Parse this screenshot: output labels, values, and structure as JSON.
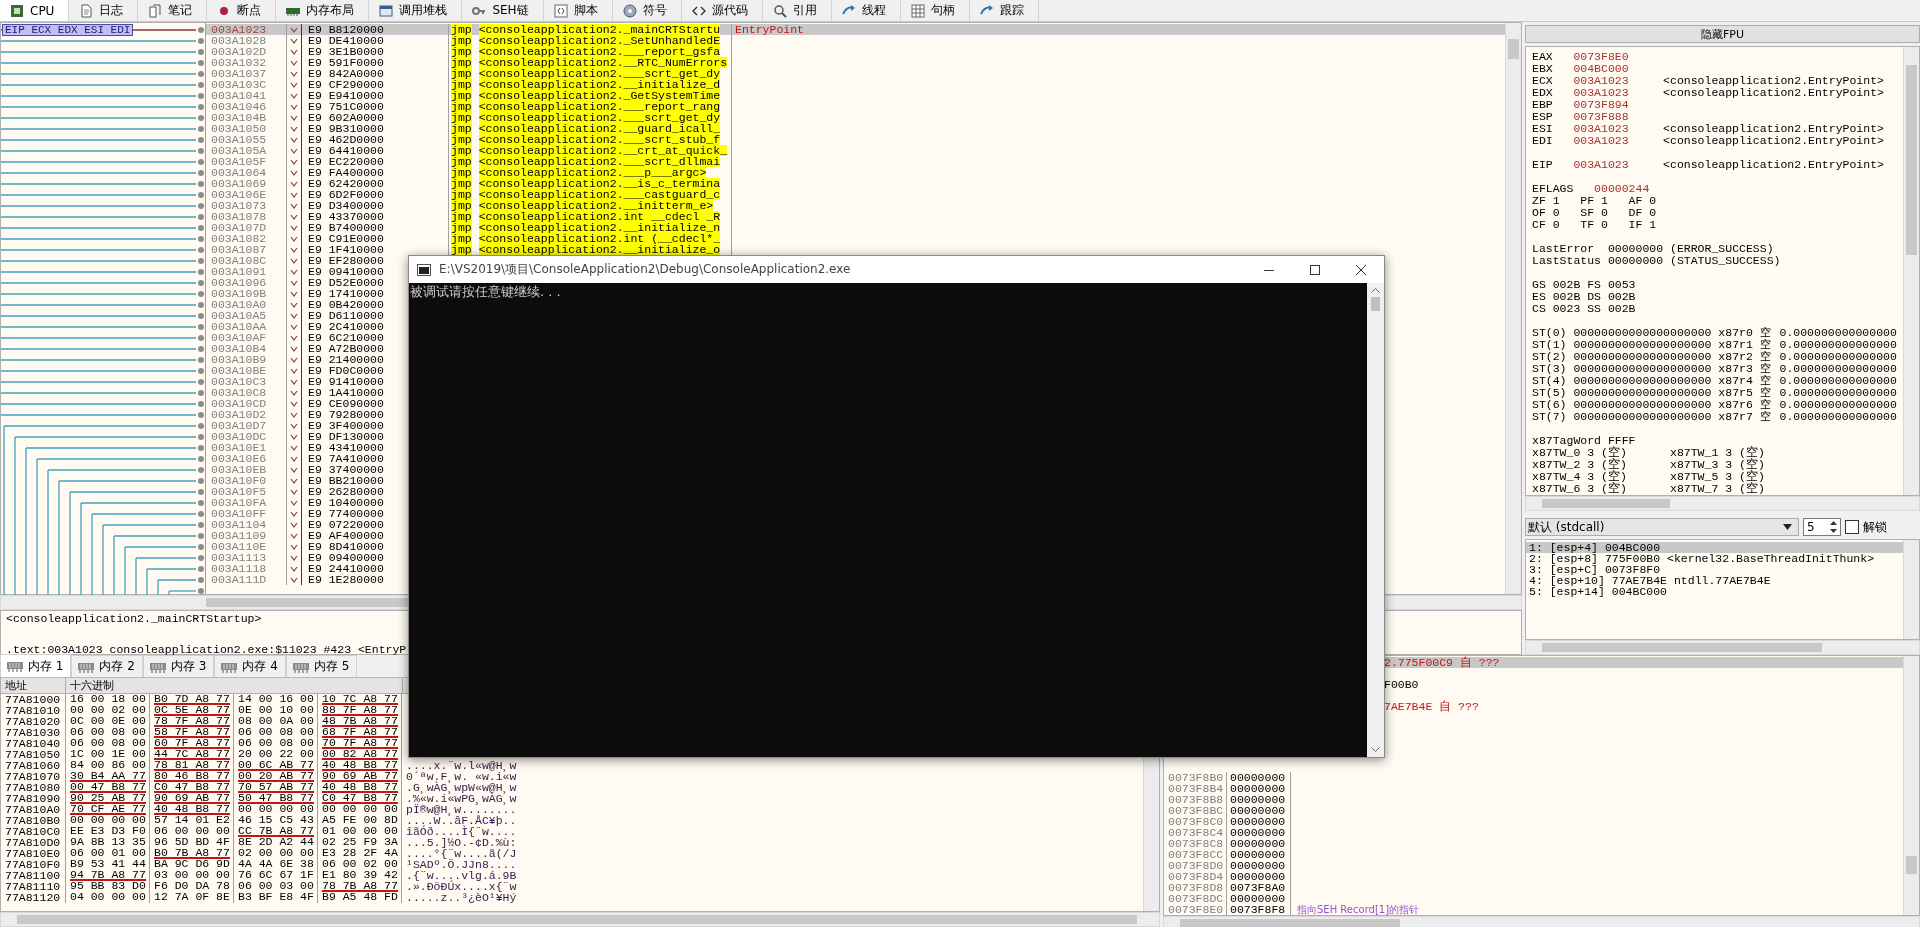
{
  "tabs": [
    {
      "label": "CPU",
      "selected": true
    },
    {
      "label": "日志",
      "selected": false
    },
    {
      "label": "笔记",
      "selected": false
    },
    {
      "label": "断点",
      "selected": false
    },
    {
      "label": "内存布局",
      "selected": false
    },
    {
      "label": "调用堆栈",
      "selected": false
    },
    {
      "label": "SEH链",
      "selected": false
    },
    {
      "label": "脚本",
      "selected": false
    },
    {
      "label": "符号",
      "selected": false
    },
    {
      "label": "源代码",
      "selected": false
    },
    {
      "label": "引用",
      "selected": false
    },
    {
      "label": "线程",
      "selected": false
    },
    {
      "label": "句柄",
      "selected": false
    },
    {
      "label": "跟踪",
      "selected": false
    }
  ],
  "disassembly": {
    "register_label": "EIP ECX EDX ESI EDI",
    "rows": [
      {
        "address": "003A1023",
        "bytes": "E9 B8120000",
        "mnemonic": "jmp",
        "operand": "<consoleapplication2._mainCRTStartu",
        "comment": "EntryPoint",
        "selected": true
      },
      {
        "address": "003A1028",
        "bytes": "E9 DE410000",
        "mnemonic": "jmp",
        "operand": "<consoleapplication2._SetUnhandledE",
        "selected": false
      },
      {
        "address": "003A102D",
        "bytes": "E9 3E1B0000",
        "mnemonic": "jmp",
        "operand": "<consoleapplication2.___report_gsfa",
        "selected": false
      },
      {
        "address": "003A1032",
        "bytes": "E9 591F0000",
        "mnemonic": "jmp",
        "operand": "<consoleapplication2.__RTC_NumErrors",
        "selected": false
      },
      {
        "address": "003A1037",
        "bytes": "E9 842A0000",
        "mnemonic": "jmp",
        "operand": "<consoleapplication2.___scrt_get_dy",
        "selected": false
      },
      {
        "address": "003A103C",
        "bytes": "E9 CF290000",
        "mnemonic": "jmp",
        "operand": "<consoleapplication2.__initialize_d",
        "selected": false
      },
      {
        "address": "003A1041",
        "bytes": "E9 E9410000",
        "mnemonic": "jmp",
        "operand": "<consoleapplication2._GetSystemTime",
        "selected": false
      },
      {
        "address": "003A1046",
        "bytes": "E9 751C0000",
        "mnemonic": "jmp",
        "operand": "<consoleapplication2.___report_rang",
        "selected": false
      },
      {
        "address": "003A104B",
        "bytes": "E9 602A0000",
        "mnemonic": "jmp",
        "operand": "<consoleapplication2.___scrt_get_dy",
        "selected": false
      },
      {
        "address": "003A1050",
        "bytes": "E9 9B310000",
        "mnemonic": "jmp",
        "operand": "<consoleapplication2.__guard_icall_",
        "selected": false
      },
      {
        "address": "003A1055",
        "bytes": "E9 462D0000",
        "mnemonic": "jmp",
        "operand": "<consoleapplication2.___scrt_stub_f",
        "selected": false
      },
      {
        "address": "003A105A",
        "bytes": "E9 64410000",
        "mnemonic": "jmp",
        "operand": "<consoleapplication2.__crt_at_quick_",
        "selected": false
      },
      {
        "address": "003A105F",
        "bytes": "E9 EC220000",
        "mnemonic": "jmp",
        "operand": "<consoleapplication2.___scrt_dllmai",
        "selected": false
      },
      {
        "address": "003A1064",
        "bytes": "E9 FA400000",
        "mnemonic": "jmp",
        "operand": "<consoleapplication2.___p___argc>",
        "selected": false
      },
      {
        "address": "003A1069",
        "bytes": "E9 62420000",
        "mnemonic": "jmp",
        "operand": "<consoleapplication2.__is_c_termina",
        "selected": false
      },
      {
        "address": "003A106E",
        "bytes": "E9 6D2F0000",
        "mnemonic": "jmp",
        "operand": "<consoleapplication2.___castguard_c",
        "selected": false
      },
      {
        "address": "003A1073",
        "bytes": "E9 D3400000",
        "mnemonic": "jmp",
        "operand": "<consoleapplication2.__initterm_e>",
        "selected": false
      },
      {
        "address": "003A1078",
        "bytes": "E9 43370000",
        "mnemonic": "jmp",
        "operand": "<consoleapplication2.int __cdecl _R",
        "selected": false
      },
      {
        "address": "003A107D",
        "bytes": "E9 B7400000",
        "mnemonic": "jmp",
        "operand": "<consoleapplication2.__initialize_n",
        "selected": false
      },
      {
        "address": "003A1082",
        "bytes": "E9 C91E0000",
        "mnemonic": "jmp",
        "operand": "<consoleapplication2.int (__cdecl*_",
        "selected": false
      },
      {
        "address": "003A1087",
        "bytes": "E9 1F410000",
        "mnemonic": "jmp",
        "operand": "<consoleapplication2.__initialize_o",
        "selected": false
      },
      {
        "address": "003A108C",
        "bytes": "E9 EF280000",
        "selected": false
      },
      {
        "address": "003A1091",
        "bytes": "E9 09410000",
        "selected": false
      },
      {
        "address": "003A1096",
        "bytes": "E9 D52E0000",
        "selected": false
      },
      {
        "address": "003A109B",
        "bytes": "E9 17410000",
        "selected": false
      },
      {
        "address": "003A10A0",
        "bytes": "E9 0B420000",
        "selected": false
      },
      {
        "address": "003A10A5",
        "bytes": "E9 D6110000",
        "selected": false
      },
      {
        "address": "003A10AA",
        "bytes": "E9 2C410000",
        "selected": false
      },
      {
        "address": "003A10AF",
        "bytes": "E9 6C210000",
        "selected": false
      },
      {
        "address": "003A10B4",
        "bytes": "E9 A72B0000",
        "selected": false
      },
      {
        "address": "003A10B9",
        "bytes": "E9 21400000",
        "selected": false
      },
      {
        "address": "003A10BE",
        "bytes": "E9 FD0C0000",
        "selected": false
      },
      {
        "address": "003A10C3",
        "bytes": "E9 91410000",
        "selected": false
      },
      {
        "address": "003A10C8",
        "bytes": "E9 1A410000",
        "selected": false
      },
      {
        "address": "003A10CD",
        "bytes": "E9 CE090000",
        "selected": false
      },
      {
        "address": "003A10D2",
        "bytes": "E9 79280000",
        "selected": false
      },
      {
        "address": "003A10D7",
        "bytes": "E9 3F400000",
        "selected": false
      },
      {
        "address": "003A10DC",
        "bytes": "E9 DF130000",
        "selected": false
      },
      {
        "address": "003A10E1",
        "bytes": "E9 43410000",
        "selected": false
      },
      {
        "address": "003A10E6",
        "bytes": "E9 7A410000",
        "selected": false
      },
      {
        "address": "003A10EB",
        "bytes": "E9 37400000",
        "selected": false
      },
      {
        "address": "003A10F0",
        "bytes": "E9 BB210000",
        "selected": false
      },
      {
        "address": "003A10F5",
        "bytes": "E9 26280000",
        "selected": false
      },
      {
        "address": "003A10FA",
        "bytes": "E9 10400000",
        "selected": false
      },
      {
        "address": "003A10FF",
        "bytes": "E9 77400000",
        "selected": false
      },
      {
        "address": "003A1104",
        "bytes": "E9 07220000",
        "selected": false
      },
      {
        "address": "003A1109",
        "bytes": "E9 AF400000",
        "selected": false
      },
      {
        "address": "003A110E",
        "bytes": "E9 8D410000",
        "selected": false
      },
      {
        "address": "003A1113",
        "bytes": "E9 09400000",
        "selected": false
      },
      {
        "address": "003A1118",
        "bytes": "E9 24410000",
        "selected": false
      },
      {
        "address": "003A111D",
        "bytes": "E9 1E280000",
        "selected": false
      }
    ]
  },
  "info": [
    "<consoleapplication2._mainCRTStartup>",
    ".text:003A1023 consoleapplication2.exe:$11023 #423 <EntryP"
  ],
  "registers": {
    "hide_fpu": "隐藏FPU",
    "general": [
      {
        "name": "EAX",
        "value": "0073F8E0"
      },
      {
        "name": "EBX",
        "value": "004BC000"
      },
      {
        "name": "ECX",
        "value": "003A1023",
        "comment": "<consoleapplication2.EntryPoint>"
      },
      {
        "name": "EDX",
        "value": "003A1023",
        "comment": "<consoleapplication2.EntryPoint>"
      },
      {
        "name": "EBP",
        "value": "0073F894"
      },
      {
        "name": "ESP",
        "value": "0073F888"
      },
      {
        "name": "ESI",
        "value": "003A1023",
        "comment": "<consoleapplication2.EntryPoint>"
      },
      {
        "name": "EDI",
        "value": "003A1023",
        "comment": "<consoleapplication2.EntryPoint>"
      }
    ],
    "eip": {
      "name": "EIP",
      "value": "003A1023",
      "comment": "<consoleapplication2.EntryPoint>"
    },
    "eflags": {
      "name": "EFLAGS",
      "value": "00000244"
    },
    "flags": [
      [
        {
          "name": "ZF",
          "value": "1"
        },
        {
          "name": "PF",
          "value": "1"
        },
        {
          "name": "AF",
          "value": "0"
        }
      ],
      [
        {
          "name": "OF",
          "value": "0"
        },
        {
          "name": "SF",
          "value": "0"
        },
        {
          "name": "DF",
          "value": "0"
        }
      ],
      [
        {
          "name": "CF",
          "value": "0"
        },
        {
          "name": "TF",
          "value": "0"
        },
        {
          "name": "IF",
          "value": "1"
        }
      ]
    ],
    "last": [
      {
        "name": "LastError",
        "value": "00000000",
        "comment": "(ERROR_SUCCESS)"
      },
      {
        "name": "LastStatus",
        "value": "00000000",
        "comment": "(STATUS_SUCCESS)"
      }
    ],
    "segments": [
      [
        {
          "name": "GS",
          "value": "002B"
        },
        {
          "name": "FS",
          "value": "0053"
        }
      ],
      [
        {
          "name": "ES",
          "value": "002B"
        },
        {
          "name": "DS",
          "value": "002B"
        }
      ],
      [
        {
          "name": "CS",
          "value": "0023"
        },
        {
          "name": "SS",
          "value": "002B"
        }
      ]
    ],
    "fpu": [
      {
        "name": "ST(0)",
        "value": "00000000000000000000",
        "tag_register": "x87r0",
        "tag": "空",
        "float": "0.000000000000000"
      },
      {
        "name": "ST(1)",
        "value": "00000000000000000000",
        "tag_register": "x87r1",
        "tag": "空",
        "float": "0.000000000000000"
      },
      {
        "name": "ST(2)",
        "value": "00000000000000000000",
        "tag_register": "x87r2",
        "tag": "空",
        "float": "0.000000000000000"
      },
      {
        "name": "ST(3)",
        "value": "00000000000000000000",
        "tag_register": "x87r3",
        "tag": "空",
        "float": "0.000000000000000"
      },
      {
        "name": "ST(4)",
        "value": "00000000000000000000",
        "tag_register": "x87r4",
        "tag": "空",
        "float": "0.000000000000000"
      },
      {
        "name": "ST(5)",
        "value": "00000000000000000000",
        "tag_register": "x87r5",
        "tag": "空",
        "float": "0.000000000000000"
      },
      {
        "name": "ST(6)",
        "value": "00000000000000000000",
        "tag_register": "x87r6",
        "tag": "空",
        "float": "0.000000000000000"
      },
      {
        "name": "ST(7)",
        "value": "00000000000000000000",
        "tag_register": "x87r7",
        "tag": "空",
        "float": "0.000000000000000"
      }
    ],
    "tag_word": {
      "name": "x87TagWord",
      "value": "FFFF"
    },
    "tag_words": [
      [
        {
          "name": "x87TW_0",
          "value": "3 (空)"
        },
        {
          "name": "x87TW_1",
          "value": "3 (空)"
        }
      ],
      [
        {
          "name": "x87TW_2",
          "value": "3 (空)"
        },
        {
          "name": "x87TW_3",
          "value": "3 (空)"
        }
      ],
      [
        {
          "name": "x87TW_4",
          "value": "3 (空)"
        },
        {
          "name": "x87TW_5",
          "value": "3 (空)"
        }
      ],
      [
        {
          "name": "x87TW_6",
          "value": "3 (空)"
        },
        {
          "name": "x87TW_7",
          "value": "3 (空)"
        }
      ]
    ]
  },
  "arguments": {
    "convention": "默认 (stdcall)",
    "count": "5",
    "unlock": {
      "label": "解锁",
      "checked": false
    },
    "rows": [
      {
        "text": "1: [esp+4] 004BC000",
        "selected": true
      },
      {
        "text": "2: [esp+8] 775F00B0 <kernel32.BaseThreadInitThunk>",
        "selected": false
      },
      {
        "text": "3: [esp+C] 0073F8F0",
        "selected": false
      },
      {
        "text": "4: [esp+10] 77AE7B4E ntdll.77AE7B4E",
        "selected": false
      },
      {
        "text": "5: [esp+14] 004BC000",
        "selected": false
      }
    ]
  },
  "memory_tabs": [
    {
      "label": "内存 1",
      "selected": true
    },
    {
      "label": "内存 2",
      "selected": false
    },
    {
      "label": "内存 3",
      "selected": false
    },
    {
      "label": "内存 4",
      "selected": false
    },
    {
      "label": "内存 5",
      "selected": false
    }
  ],
  "dump": {
    "columns": [
      "地址",
      "十六进制"
    ],
    "rows": [
      {
        "address": "77A81000",
        "groups": [
          "16 00 18 00",
          "B0 7D A8 77",
          "14 00 16 00",
          "10 7C A8 77"
        ],
        "underlined": [
          false,
          true,
          false,
          true
        ]
      },
      {
        "address": "77A81010",
        "groups": [
          "00 00 02 00",
          "0C 5E A8 77",
          "0E 00 10 00",
          "88 7F A8 77"
        ],
        "underlined": [
          false,
          true,
          false,
          true
        ]
      },
      {
        "address": "77A81020",
        "groups": [
          "0C 00 0E 00",
          "78 7F A8 77",
          "08 00 0A 00",
          "48 7B A8 77"
        ],
        "underlined": [
          false,
          true,
          false,
          true
        ]
      },
      {
        "address": "77A81030",
        "groups": [
          "06 00 08 00",
          "58 7F A8 77",
          "06 00 08 00",
          "68 7F A8 77"
        ],
        "underlined": [
          false,
          true,
          false,
          true
        ]
      },
      {
        "address": "77A81040",
        "groups": [
          "06 00 08 00",
          "60 7F A8 77",
          "06 00 08 00",
          "70 7F A8 77"
        ],
        "underlined": [
          false,
          true,
          false,
          true
        ]
      },
      {
        "address": "77A81050",
        "groups": [
          "1C 00 1E 00",
          "44 7C A8 77",
          "20 00 22 00",
          "00 82 A8 77"
        ],
        "underlined": [
          false,
          true,
          false,
          true
        ]
      },
      {
        "address": "77A81060",
        "groups": [
          "84 00 86 00",
          "78 81 A8 77",
          "00 6C AB 77",
          "40 48 B8 77"
        ],
        "underlined": [
          false,
          true,
          true,
          true
        ],
        "ascii": "....x.¨w.l«w@H¸w"
      },
      {
        "address": "77A81070",
        "groups": [
          "30 B4 AA 77",
          "80 46 B8 77",
          "00 20 AB 77",
          "90 69 AB 77"
        ],
        "underlined": [
          true,
          true,
          true,
          true
        ],
        "ascii": "0´ªw.F¸w. «w.i«w"
      },
      {
        "address": "77A81080",
        "groups": [
          "00 47 B8 77",
          "C0 47 B8 77",
          "70 57 AB 77",
          "40 48 B8 77"
        ],
        "underlined": [
          true,
          true,
          true,
          true
        ],
        "ascii": ".G¸wÀG¸wpW«w@H¸w"
      },
      {
        "address": "77A81090",
        "groups": [
          "90 25 AB 77",
          "90 69 AB 77",
          "50 47 B8 77",
          "C0 47 B8 77"
        ],
        "underlined": [
          true,
          true,
          true,
          true
        ],
        "ascii": ".%«w.i«wPG¸wÀG¸w"
      },
      {
        "address": "77A810A0",
        "groups": [
          "70 CF AE 77",
          "40 48 B8 77",
          "00 00 00 00",
          "00 00 00 00"
        ],
        "underlined": [
          true,
          true,
          false,
          false
        ],
        "ascii": "pÏ®w@H¸w........"
      },
      {
        "address": "77A810B0",
        "groups": [
          "00 00 00 00",
          "57 14 01 E2",
          "46 15 C5 43",
          "A5 FE 00 8D"
        ],
        "underlined": [
          false,
          false,
          false,
          false
        ],
        "ascii": "....W..âF.ÅC¥þ.."
      },
      {
        "address": "77A810C0",
        "groups": [
          "EE E3 D3 F0",
          "06 00 00 00",
          "CC 7B A8 77",
          "01 00 00 00"
        ],
        "underlined": [
          false,
          false,
          true,
          false
        ],
        "ascii": "îãÓð....Ì{¨w...."
      },
      {
        "address": "77A810D0",
        "groups": [
          "9A 8B 13 35",
          "96 5D BD 4F",
          "8E 2D A2 44",
          "02 25 F9 3A"
        ],
        "underlined": [
          false,
          false,
          false,
          false
        ],
        "ascii": "...5.]½O.-¢D.%ù:"
      },
      {
        "address": "77A810E0",
        "groups": [
          "06 00 01 00",
          "B0 7B A8 77",
          "02 00 00 00",
          "E3 28 2F 4A"
        ],
        "underlined": [
          false,
          true,
          false,
          false
        ],
        "ascii": "....°{¨w....ã(/J"
      },
      {
        "address": "77A810F0",
        "groups": [
          "B9 53 41 44",
          "BA 9C D6 9D",
          "4A 4A 6E 38",
          "06 00 02 00"
        ],
        "underlined": [
          false,
          false,
          false,
          false
        ],
        "ascii": "¹SADº.Ö.JJn8...."
      },
      {
        "address": "77A81100",
        "groups": [
          "94 7B A8 77",
          "03 00 00 00",
          "76 6C 67 1F",
          "E1 80 39 42"
        ],
        "underlined": [
          true,
          false,
          false,
          false
        ],
        "ascii": ".{¨w....vlg.á.9B"
      },
      {
        "address": "77A81110",
        "groups": [
          "95 BB 83 D0",
          "F6 D0 DA 78",
          "06 00 03 00",
          "78 7B A8 77"
        ],
        "underlined": [
          false,
          false,
          false,
          true
        ],
        "ascii": ".».ÐöÐÚx....x{¨w"
      },
      {
        "address": "77A81120",
        "groups": [
          "04 00 00 00",
          "12 7A 0F 8E",
          "B3 BF E8 4F",
          "B9 A5 48 FD"
        ],
        "underlined": [
          false,
          false,
          false,
          false
        ],
        "ascii": ".....z..³¿èO¹¥Hý"
      }
    ]
  },
  "stack": {
    "partial_rows": [
      {
        "text": "2.775F00C9 自 ???",
        "kind": "return",
        "selected": true
      },
      {
        "text": "F00B0",
        "kind": "value",
        "selected": false
      },
      {
        "text": "7AE7B4E 自 ???",
        "kind": "return",
        "selected": false
      }
    ],
    "rows": [
      {
        "address": "0073F8B0",
        "value": "00000000"
      },
      {
        "address": "0073F8B4",
        "value": "00000000"
      },
      {
        "address": "0073F8B8",
        "value": "00000000"
      },
      {
        "address": "0073F8BC",
        "value": "00000000"
      },
      {
        "address": "0073F8C0",
        "value": "00000000"
      },
      {
        "address": "0073F8C4",
        "value": "00000000"
      },
      {
        "address": "0073F8C8",
        "value": "00000000"
      },
      {
        "address": "0073F8CC",
        "value": "00000000"
      },
      {
        "address": "0073F8D0",
        "value": "00000000"
      },
      {
        "address": "0073F8D4",
        "value": "00000000"
      },
      {
        "address": "0073F8D8",
        "value": "0073F8A0"
      },
      {
        "address": "0073F8DC",
        "value": "00000000"
      },
      {
        "address": "0073F8E0",
        "value": "0073F8F8",
        "comment": "指向SEH Record[1]的指针"
      }
    ]
  },
  "console": {
    "title": "E:\\VS2019\\项目\\ConsoleApplication2\\Debug\\ConsoleApplication2.exe",
    "output": "被调试请按任意键继续. . ."
  }
}
